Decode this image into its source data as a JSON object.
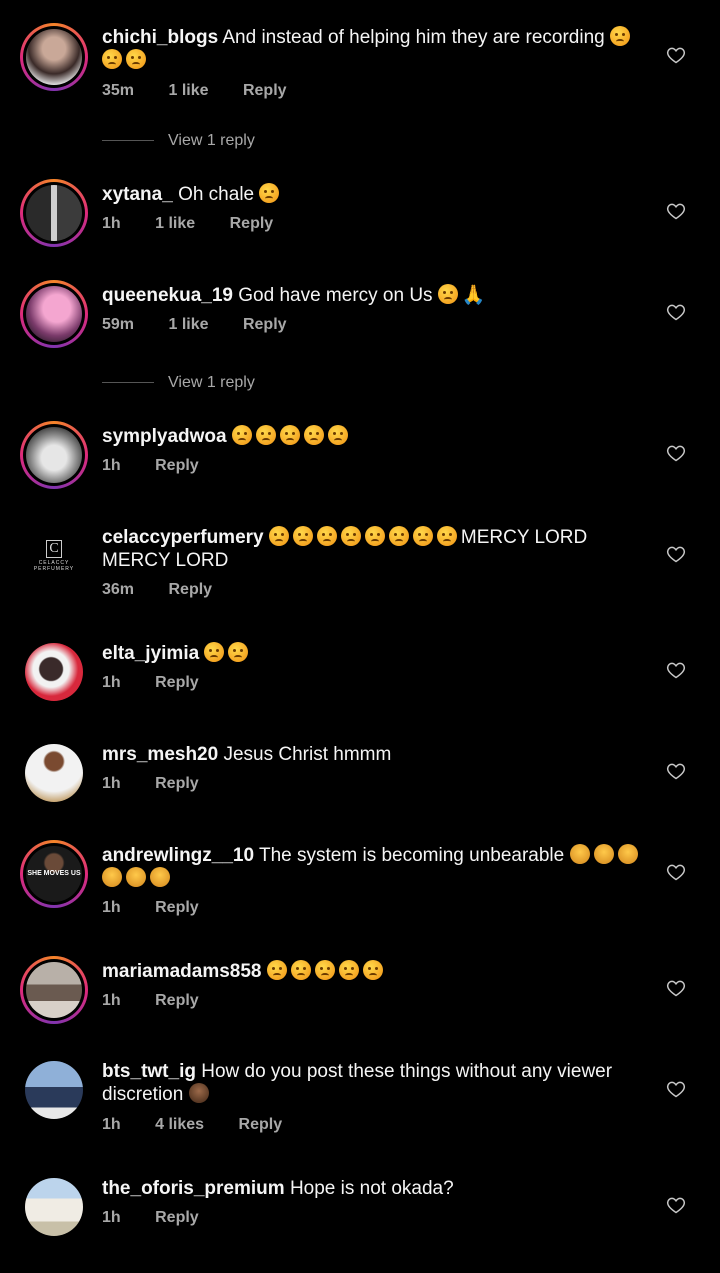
{
  "comments": [
    {
      "username": "chichi_blogs",
      "text": "And instead of helping him they are recording",
      "emoji": "😢😢😢",
      "time": "35m",
      "likes": "1 like",
      "reply": "Reply"
    },
    {
      "username": "xytana_",
      "text": "Oh chale",
      "emoji": "😢",
      "time": "1h",
      "likes": "1 like",
      "reply": "Reply"
    },
    {
      "username": "queenekua_19",
      "text": "God have mercy on Us",
      "emoji": "😢🙏",
      "time": "59m",
      "likes": "1 like",
      "reply": "Reply"
    },
    {
      "username": "symplyadwoa",
      "text": "",
      "emoji": "😢😢😢😢😢",
      "time": "1h",
      "likes": "",
      "reply": "Reply"
    },
    {
      "username": "celaccyperfumery",
      "text": "MERCY LORD MERCY LORD",
      "emoji": "😢😢😢😢😢😢😢😢",
      "time": "36m",
      "likes": "",
      "reply": "Reply",
      "avatar_text": "C",
      "avatar_brand": "CELACCY PERFUMERY"
    },
    {
      "username": "elta_jyimia",
      "text": "",
      "emoji": "😢😢",
      "time": "1h",
      "likes": "",
      "reply": "Reply"
    },
    {
      "username": "mrs_mesh20",
      "text": "Jesus Christ hmmm",
      "emoji": "",
      "time": "1h",
      "likes": "",
      "reply": "Reply"
    },
    {
      "username": "andrewlingz__10",
      "text": "The system is becoming unbearable",
      "emoji": "🤦🤦🤦🤦🤦🤦",
      "time": "1h",
      "likes": "",
      "reply": "Reply",
      "avatar_text": "SHE MOVES US"
    },
    {
      "username": "mariamadams858",
      "text": "",
      "emoji": "😢😢😢😢😢",
      "time": "1h",
      "likes": "",
      "reply": "Reply"
    },
    {
      "username": "bts_twt_ig",
      "text": "How do you post these things without any viewer discretion",
      "emoji": "🤦🏾‍♀️",
      "time": "1h",
      "likes": "4 likes",
      "reply": "Reply"
    },
    {
      "username": "the_oforis_premium",
      "text": "Hope is not okada?",
      "emoji": "",
      "time": "1h",
      "likes": "",
      "reply": "Reply"
    }
  ],
  "view_reply_1": "View 1 reply",
  "view_reply_2": "View 1 reply",
  "colors": {
    "background": "#000000",
    "text": "#f5f5f5",
    "meta": "#a8a8a8",
    "story_ring": "#dd2a7b"
  },
  "icons": {
    "like": "heart-outline-icon"
  }
}
